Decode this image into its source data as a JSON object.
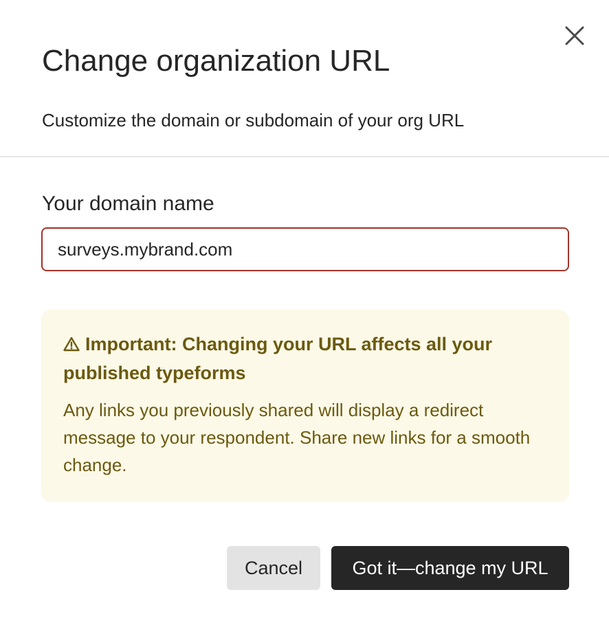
{
  "dialog": {
    "title": "Change organization URL",
    "subtitle": "Customize the domain or subdomain of your org URL",
    "close_icon": "close-icon"
  },
  "form": {
    "label": "Your domain name",
    "value": "surveys.mybrand.com",
    "border_color": "#a3332a"
  },
  "notice": {
    "icon": "warning-icon",
    "title": "Important: Changing your URL affects all your published typeforms",
    "body": "Any links you previously shared will display a redirect message to your respondent. Share new links for a smooth change.",
    "background": "#fdf9e8",
    "text_color": "#6b5a10"
  },
  "actions": {
    "cancel_label": "Cancel",
    "confirm_label": "Got it—change my URL"
  }
}
